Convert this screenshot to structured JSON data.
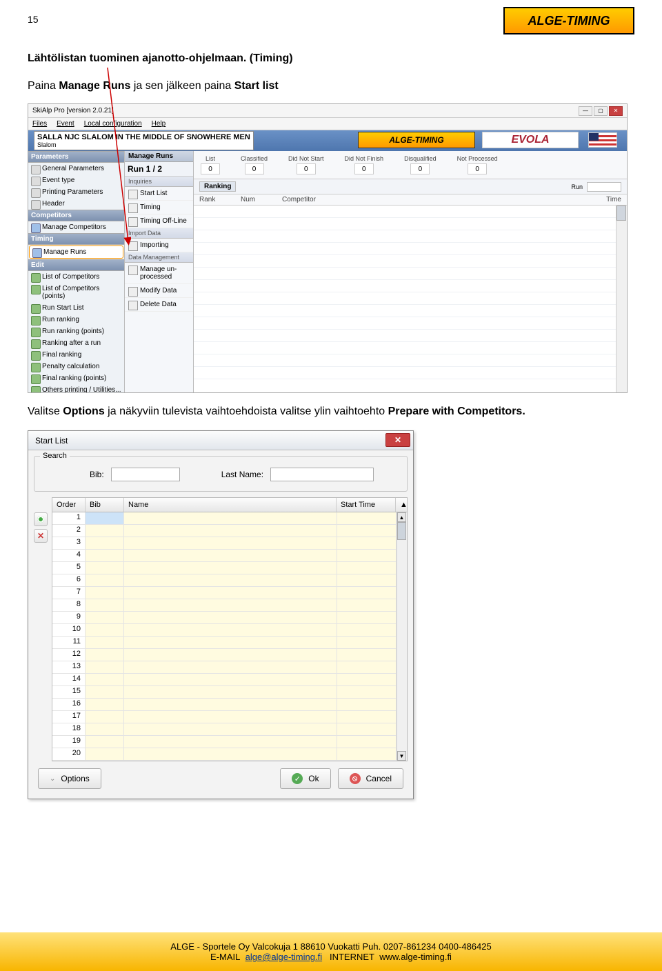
{
  "page_number": "15",
  "top_logo": "ALGE-TIMING",
  "heading": "Lähtölistan tuominen ajanotto-ohjelmaan. (Timing)",
  "para1_a": "Paina ",
  "para1_b": "Manage Runs",
  "para1_c": " ja sen jälkeen paina ",
  "para1_d": "Start list",
  "para2_a": "Valitse ",
  "para2_b": "Options",
  "para2_c": " ja näkyviin tulevista vaihtoehdoista valitse ylin vaihtoehto ",
  "para2_d": "Prepare with Competitors.",
  "app": {
    "title": "SkiAlp Pro [version 2.0.21]",
    "menus": [
      "Files",
      "Event",
      "Local configuration",
      "Help"
    ],
    "event_title": "SALLA NJC SLALOM IN THE MIDDLE OF SNOWHERE MEN",
    "event_sub": "Slalom",
    "brand1": "ALGE-TIMING",
    "brand2": "EVOLA",
    "sidebar_sections": {
      "Parameters": [
        "General Parameters",
        "Event type",
        "Printing Parameters",
        "Header"
      ],
      "Competitors": [
        "Manage Competitors"
      ],
      "Timing": [
        "Manage Runs"
      ],
      "Edit": [
        "List of Competitors",
        "List of Competitors (points)",
        "Run Start List",
        "Run ranking",
        "Run ranking (points)",
        "Ranking after a run",
        "Final ranking",
        "Penalty calculation",
        "Final ranking (points)",
        "Others printing / Utilities..."
      ]
    },
    "mid": {
      "header": "Manage Runs",
      "run": "Run 1 / 2",
      "inquiries": "Inquiries",
      "items1": [
        "Start List",
        "Timing",
        "Timing Off-Line"
      ],
      "sec_import": "Import Data",
      "items2": [
        "Importing"
      ],
      "sec_data": "Data Management",
      "items3": [
        "Manage un-processed",
        "Modify Data",
        "Delete Data"
      ]
    },
    "stats": [
      {
        "lbl": "List",
        "val": "0"
      },
      {
        "lbl": "Classified",
        "val": "0"
      },
      {
        "lbl": "Did Not Start",
        "val": "0"
      },
      {
        "lbl": "Did Not Finish",
        "val": "0"
      },
      {
        "lbl": "Disqualified",
        "val": "0"
      },
      {
        "lbl": "Not Processed",
        "val": "0"
      }
    ],
    "ranking_label": "Ranking",
    "run_label": "Run",
    "cols": [
      "Rank",
      "Num",
      "Competitor",
      "Time"
    ]
  },
  "dialog": {
    "title": "Start List",
    "search_legend": "Search",
    "bib_lbl": "Bib:",
    "ln_lbl": "Last Name:",
    "cols": {
      "order": "Order",
      "bib": "Bib",
      "name": "Name",
      "start": "Start Time"
    },
    "rows": [
      "1",
      "2",
      "3",
      "4",
      "5",
      "6",
      "7",
      "8",
      "9",
      "10",
      "11",
      "12",
      "13",
      "14",
      "15",
      "16",
      "17",
      "18",
      "19",
      "20"
    ],
    "options": "Options",
    "ok": "Ok",
    "cancel": "Cancel"
  },
  "footer": {
    "line1": "ALGE - Sportele Oy Valcokuja 1 88610 Vuokatti  Puh. 0207-861234  0400-486425",
    "email_lbl": "E-MAIL",
    "email": "alge@alge-timing.fi",
    "inet_lbl": "INTERNET",
    "inet": "www.alge-timing.fi"
  }
}
